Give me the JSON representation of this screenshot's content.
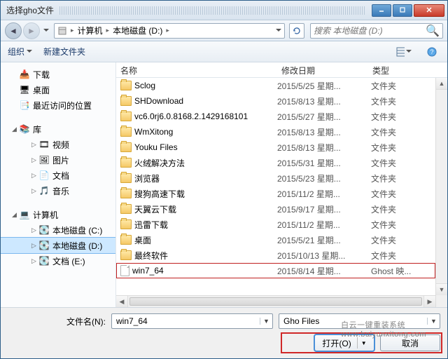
{
  "title": "选择gho文件",
  "breadcrumb": {
    "seg0": "计算机",
    "seg1": "本地磁盘 (D:)"
  },
  "search_placeholder": "搜索 本地磁盘 (D:)",
  "toolbar": {
    "organize": "组织",
    "new_folder": "新建文件夹"
  },
  "sidebar": {
    "downloads": "下载",
    "desktop": "桌面",
    "recent": "最近访问的位置",
    "library": "库",
    "videos": "视频",
    "pictures": "图片",
    "documents": "文档",
    "music": "音乐",
    "computer": "计算机",
    "drive_c": "本地磁盘 (C:)",
    "drive_d": "本地磁盘 (D:)",
    "drive_e": "文档 (E:)"
  },
  "columns": {
    "name": "名称",
    "date": "修改日期",
    "type": "类型"
  },
  "rows": [
    {
      "name": "Sclog",
      "date": "2015/5/25 星期...",
      "type": "文件夹",
      "icon": "folder"
    },
    {
      "name": "SHDownload",
      "date": "2015/8/13 星期...",
      "type": "文件夹",
      "icon": "folder"
    },
    {
      "name": "vc6.0rj6.0.8168.2.1429168101",
      "date": "2015/5/27 星期...",
      "type": "文件夹",
      "icon": "folder"
    },
    {
      "name": "WmXitong",
      "date": "2015/8/13 星期...",
      "type": "文件夹",
      "icon": "folder"
    },
    {
      "name": "Youku Files",
      "date": "2015/8/13 星期...",
      "type": "文件夹",
      "icon": "folder"
    },
    {
      "name": "火绒解决方法",
      "date": "2015/5/31 星期...",
      "type": "文件夹",
      "icon": "folder"
    },
    {
      "name": "浏览器",
      "date": "2015/5/23 星期...",
      "type": "文件夹",
      "icon": "folder"
    },
    {
      "name": "搜狗高速下载",
      "date": "2015/11/2 星期...",
      "type": "文件夹",
      "icon": "folder"
    },
    {
      "name": "天翼云下载",
      "date": "2015/9/17 星期...",
      "type": "文件夹",
      "icon": "folder"
    },
    {
      "name": "迅雷下载",
      "date": "2015/11/2 星期...",
      "type": "文件夹",
      "icon": "folder"
    },
    {
      "name": "桌面",
      "date": "2015/5/21 星期...",
      "type": "文件夹",
      "icon": "folder"
    },
    {
      "name": "最终软件",
      "date": "2015/10/13 星期...",
      "type": "文件夹",
      "icon": "folder"
    },
    {
      "name": "win7_64",
      "date": "2015/8/14 星期...",
      "type": "Ghost 映...",
      "icon": "file",
      "selected": true
    }
  ],
  "filename_label": "文件名(N):",
  "filename_value": "win7_64",
  "filter_value": "Gho Files",
  "open_label": "打开(O)",
  "cancel_label": "取消",
  "watermark": "白云一键重装系统\nwww.baiyunxitong.com"
}
